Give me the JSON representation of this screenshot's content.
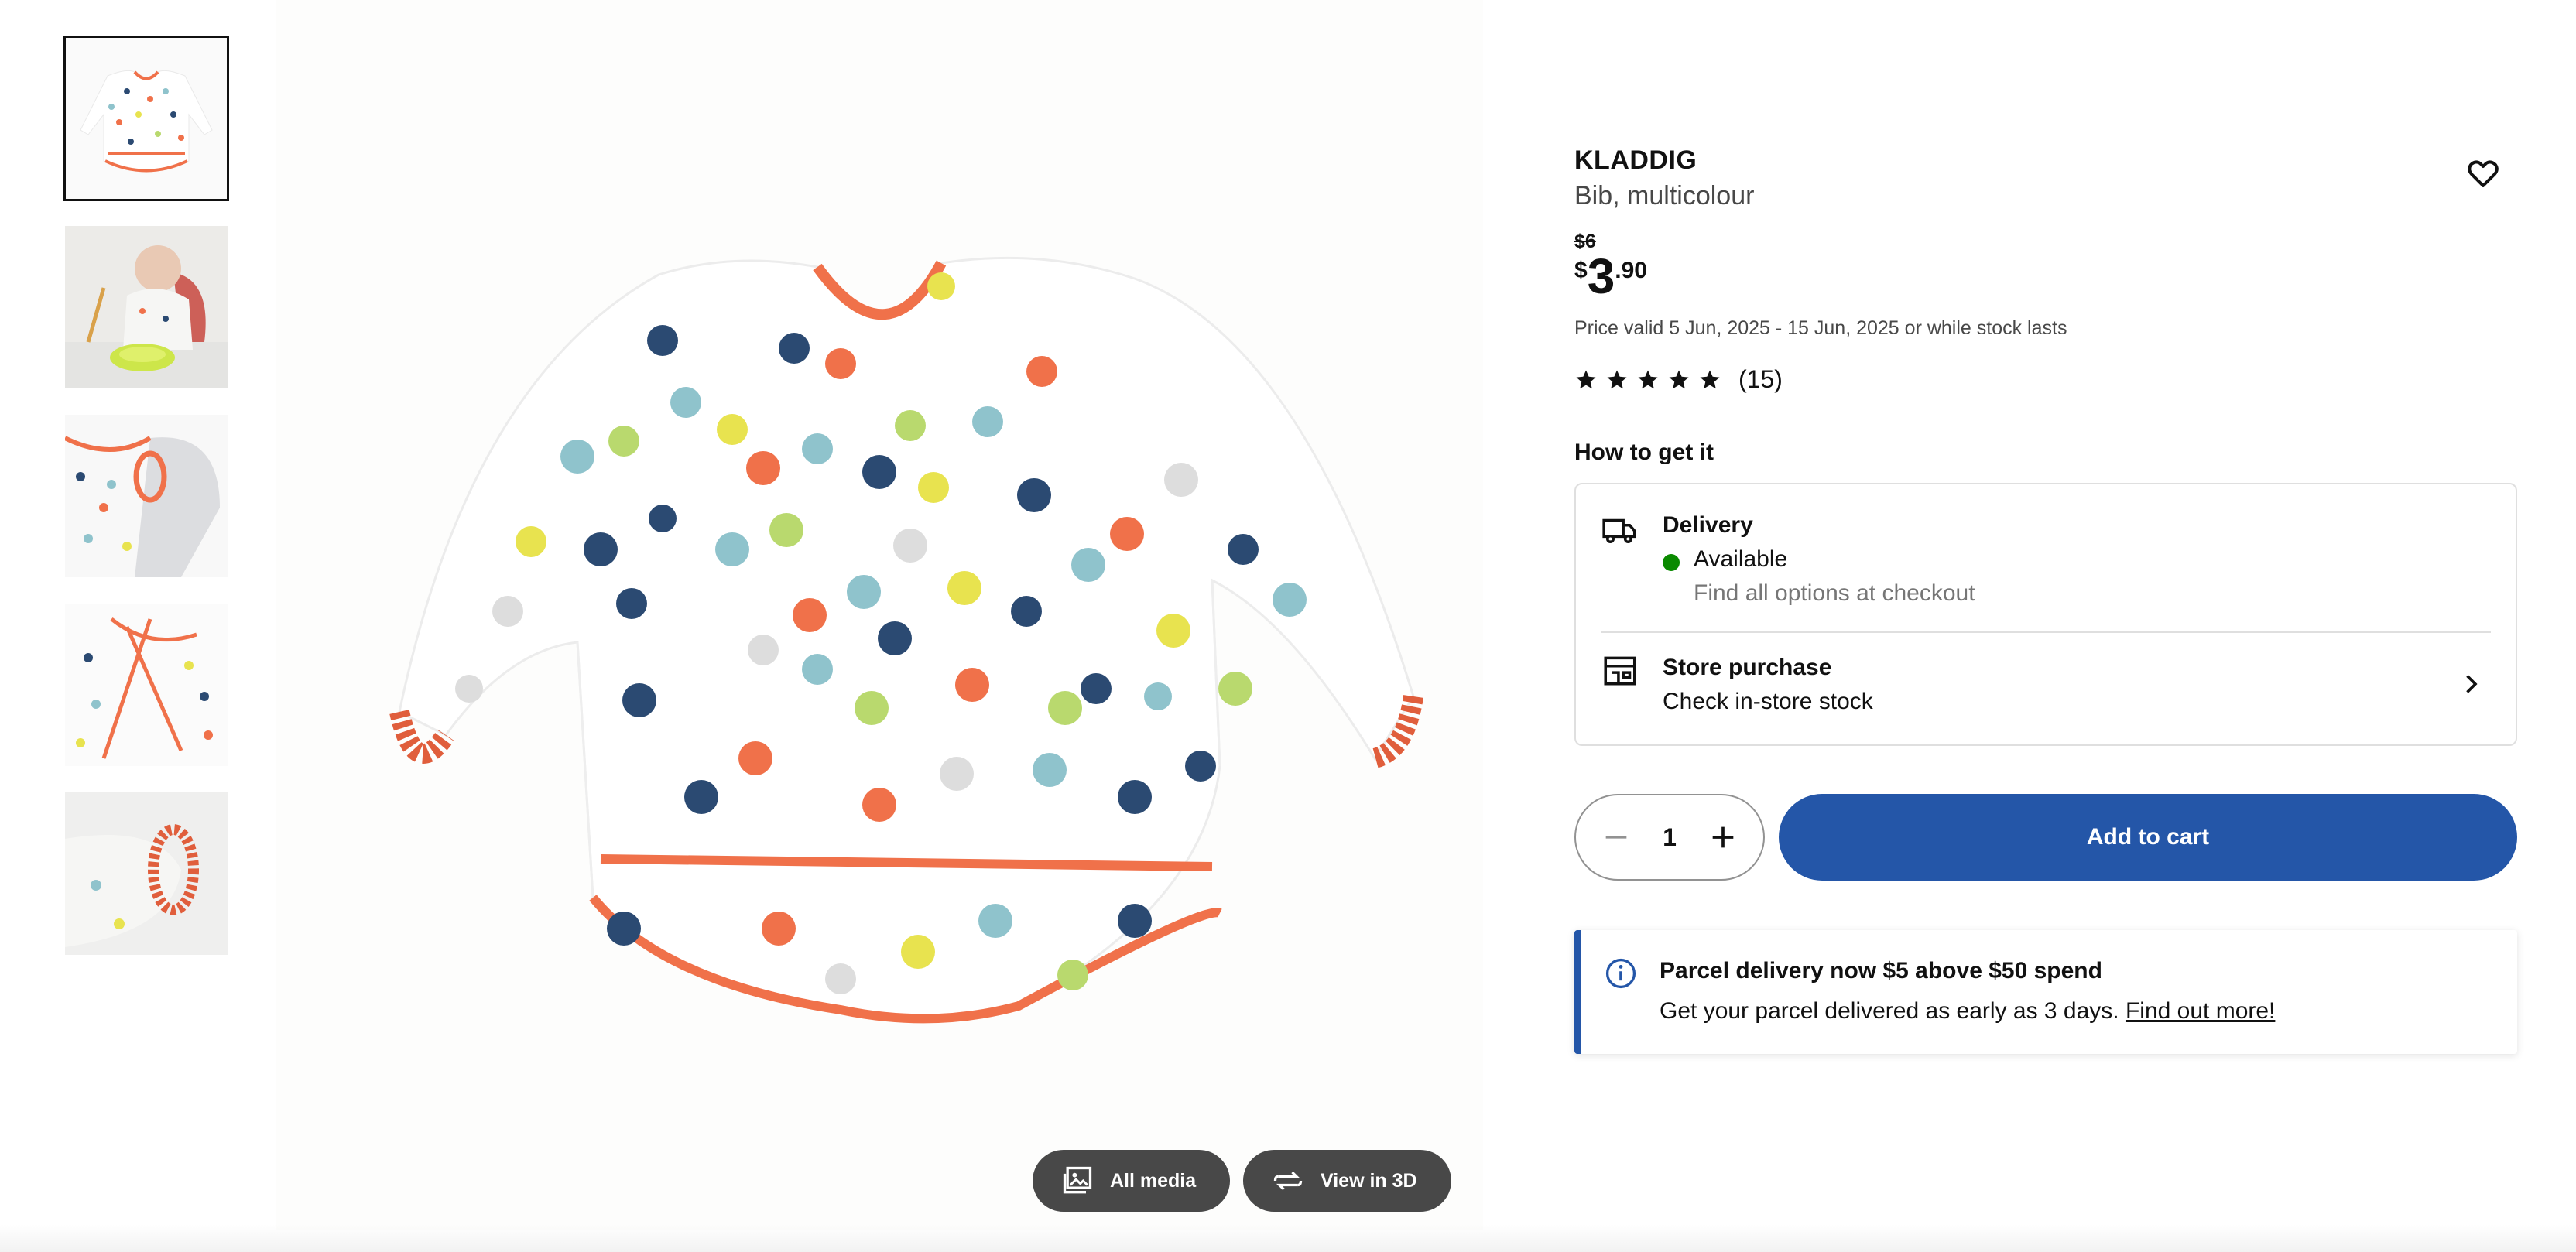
{
  "product": {
    "brand": "KLADDIG",
    "description": "Bib, multicolour",
    "old_price": "$6",
    "price_currency": "$",
    "price_integer": "3",
    "price_decimal": ".90",
    "price_validity": "Price valid 5 Jun, 2025 - 15 Jun, 2025 or while stock lasts",
    "rating_stars": 5,
    "rating_count": "(15)"
  },
  "thumbnails": [
    {
      "name": "thumb-bib-front",
      "selected": true
    },
    {
      "name": "thumb-baby-eating",
      "selected": false
    },
    {
      "name": "thumb-collar-detail",
      "selected": false
    },
    {
      "name": "thumb-ties-detail",
      "selected": false
    },
    {
      "name": "thumb-cuff-detail",
      "selected": false
    }
  ],
  "media_buttons": {
    "all_media": "All media",
    "view_3d": "View in 3D"
  },
  "availability": {
    "heading": "How to get it",
    "delivery_title": "Delivery",
    "delivery_status": "Available",
    "delivery_note": "Find all options at checkout",
    "store_title": "Store purchase",
    "store_note": "Check in-store stock"
  },
  "cart": {
    "quantity": "1",
    "add_label": "Add to cart"
  },
  "notice": {
    "title": "Parcel delivery now $5 above $50 spend",
    "text": "Get your parcel delivered as early as 3 days.",
    "link": "Find out more!"
  },
  "colors": {
    "accent_blue": "#2456a8",
    "available_green": "#0a8a00",
    "bib_trim": "#f0714a"
  },
  "icons": [
    "heart-icon",
    "star-icon",
    "truck-icon",
    "store-icon",
    "chevron-right-icon",
    "minus-icon",
    "plus-icon",
    "info-icon",
    "image-gallery-icon",
    "rotate-3d-icon"
  ]
}
